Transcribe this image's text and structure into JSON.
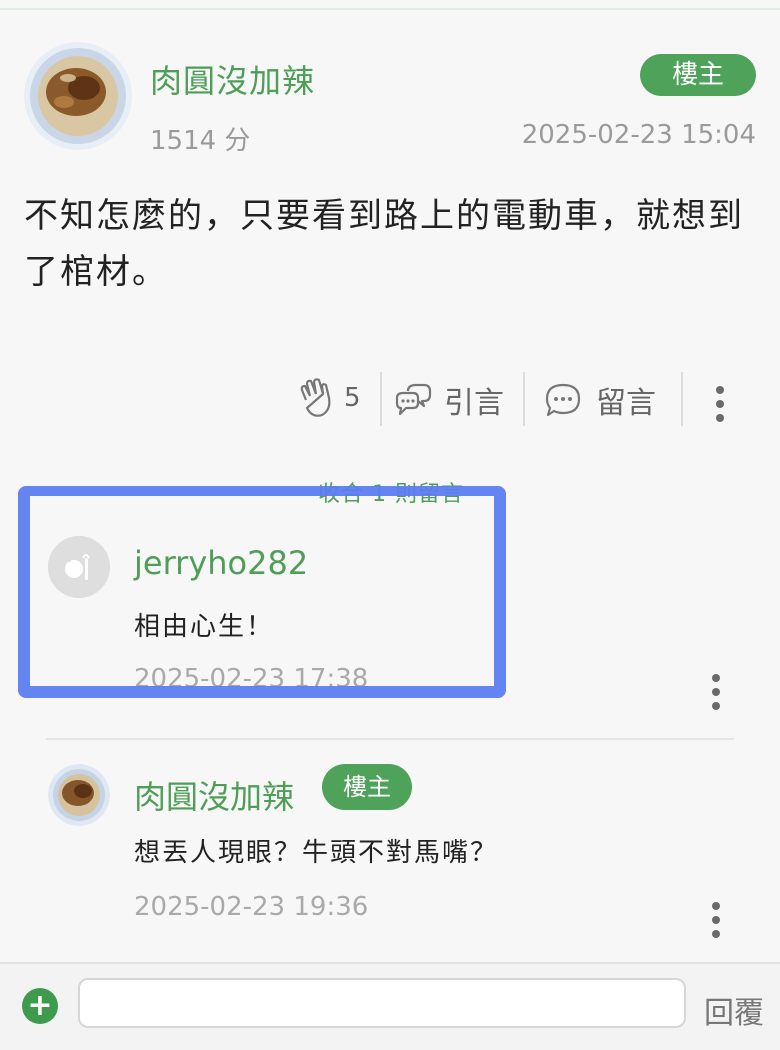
{
  "post": {
    "author": "肉圓沒加辣",
    "owner_badge": "樓主",
    "points": "1514 分",
    "time": "2025-02-23 15:04",
    "body": "不知怎麼的，只要看到路上的電動車，就想到了棺材。"
  },
  "actions": {
    "clap_count": "5",
    "quote_label": "引言",
    "comment_label": "留言"
  },
  "collapse_label": "收合 1 則留言",
  "comments": [
    {
      "author": "jerryho282",
      "text": "相由心生！",
      "time": "2025-02-23 17:38"
    },
    {
      "author": "肉圓沒加辣",
      "badge": "樓主",
      "text": "想丟人現眼？牛頭不對馬嘴？",
      "time": "2025-02-23 19:36"
    }
  ],
  "reply_bar": {
    "add_symbol": "+",
    "placeholder": "",
    "reply_label": "回覆"
  },
  "colors": {
    "accent_green": "#4ea25a",
    "highlight_blue": "#5b7df0"
  }
}
